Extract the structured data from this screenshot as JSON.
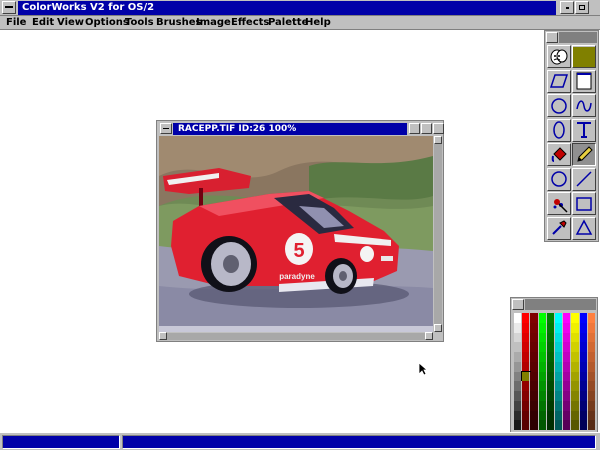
{
  "app": {
    "title": "ColorWorks V2 for OS/2"
  },
  "menu": [
    {
      "label": "File"
    },
    {
      "label": "Edit"
    },
    {
      "label": "View"
    },
    {
      "label": "Options"
    },
    {
      "label": "Tools"
    },
    {
      "label": "Brushes"
    },
    {
      "label": "Image"
    },
    {
      "label": "Effects"
    },
    {
      "label": "Palette"
    },
    {
      "label": "Help"
    }
  ],
  "image_window": {
    "title": "RACEPP.TIF ID:26  100%",
    "car_number": "5",
    "car_sponsor": "paradyne"
  },
  "tools": [
    {
      "icon": "theater-masks-icon"
    },
    {
      "icon": "color-swatch-icon"
    },
    {
      "icon": "parallelogram-icon"
    },
    {
      "icon": "page-icon"
    },
    {
      "icon": "circle-icon"
    },
    {
      "icon": "freehand-curve-icon"
    },
    {
      "icon": "ellipse-icon"
    },
    {
      "icon": "text-tool-icon"
    },
    {
      "icon": "paint-bucket-icon"
    },
    {
      "icon": "pencil-icon"
    },
    {
      "icon": "circle-outline-icon"
    },
    {
      "icon": "line-icon"
    },
    {
      "icon": "airbrush-icon"
    },
    {
      "icon": "rectangle-icon"
    },
    {
      "icon": "dropper-icon"
    },
    {
      "icon": "triangle-icon"
    }
  ],
  "colors": {
    "window_bg": "#c0c0c0",
    "active_title": "#0000a8",
    "current_color": "#808000"
  }
}
